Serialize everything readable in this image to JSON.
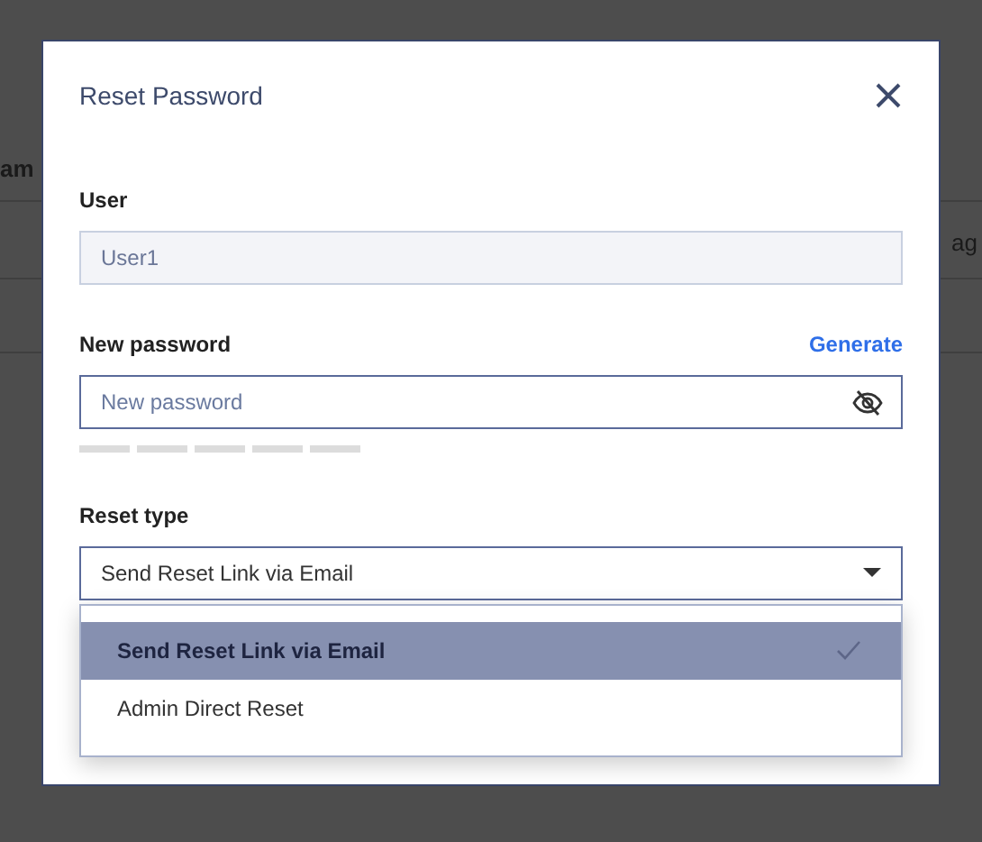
{
  "background": {
    "header_text": "am",
    "row_text": "ag"
  },
  "dialog": {
    "title": "Reset Password",
    "user": {
      "label": "User",
      "value": "User1",
      "disabled": true
    },
    "new_password": {
      "label": "New password",
      "generate_link": "Generate",
      "placeholder": "New password",
      "strength_segments": [
        {
          "filled": false
        },
        {
          "filled": false
        },
        {
          "filled": false
        },
        {
          "filled": false
        },
        {
          "filled": false
        }
      ]
    },
    "reset_type": {
      "label": "Reset type",
      "value": "Send Reset Link via Email",
      "expanded": true,
      "options": [
        {
          "label": "Send Reset Link via Email",
          "selected": true
        },
        {
          "label": "Admin Direct Reset",
          "selected": false
        }
      ]
    }
  }
}
